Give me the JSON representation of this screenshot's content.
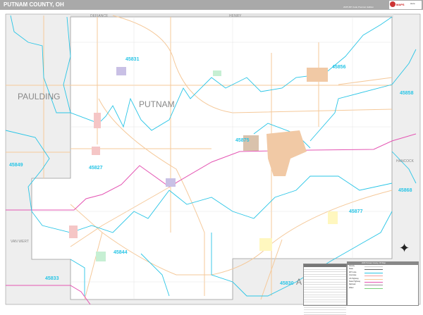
{
  "header": {
    "title": "PUTNAM COUNTY, OH",
    "edition": "2025 ZIP Code Premium Edition"
  },
  "map": {
    "county_label": "PUTNAM",
    "neighbors": {
      "paulding": "PAULDING",
      "hancock": "HANCOCK",
      "van_wert": "VAN WERT",
      "defiance": "DEFIANCE",
      "henry": "HENRY",
      "allen": "A"
    },
    "zip_codes": [
      "45831",
      "45856",
      "45858",
      "45875",
      "45849",
      "45827",
      "45868",
      "45877",
      "45844",
      "45833",
      "45830"
    ],
    "colors": {
      "zip_boundary": "#29c5e6",
      "road": "#f5c99a",
      "highway": "#e455b3",
      "county_bg": "#eeeeee",
      "title_bar": "#a9a9a9"
    }
  },
  "legend": {
    "title": "2025 Putnam County, OH Map",
    "items": [
      "County",
      "State",
      "ZIP Code",
      "Interstate",
      "US Highway",
      "State Highway",
      "Railroad",
      "Water"
    ]
  }
}
